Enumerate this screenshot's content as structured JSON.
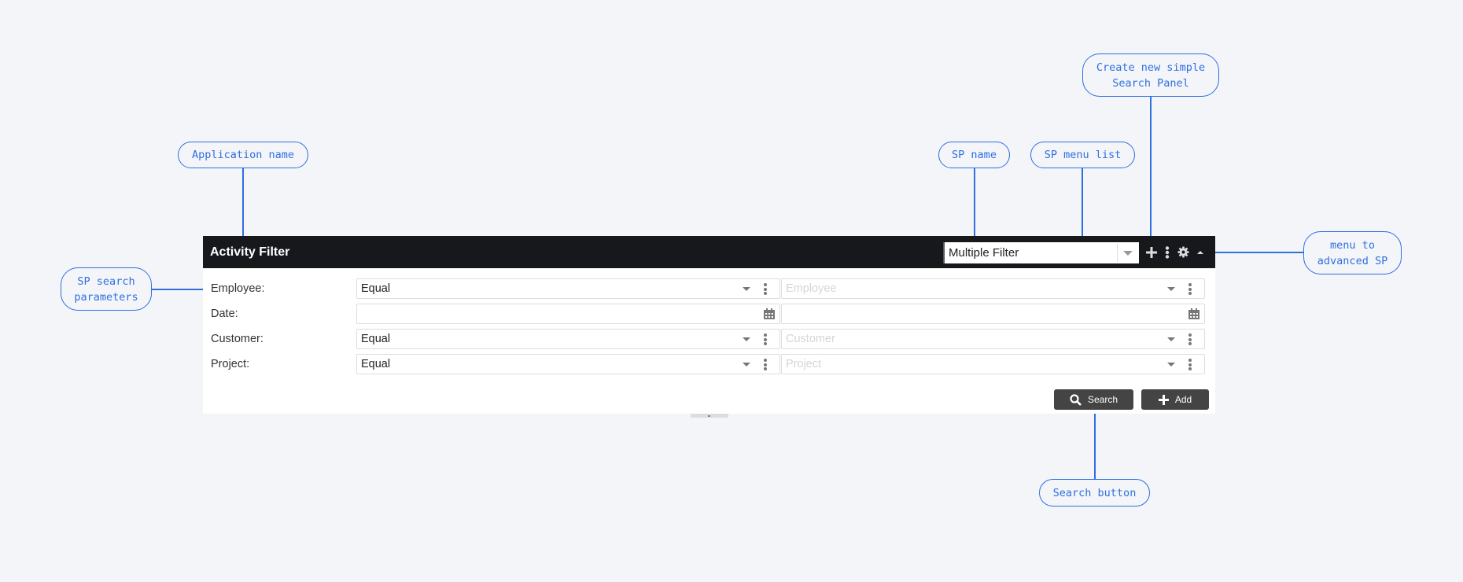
{
  "callouts": {
    "application_name": "Application name",
    "sp_search_parameters": "SP search\nparameters",
    "sp_name": "SP name",
    "sp_menu_list": "SP menu list",
    "create_new": "Create new simple\nSearch Panel",
    "menu_advanced": "menu to\nadvanced SP",
    "search_button": "Search button"
  },
  "header": {
    "title": "Activity Filter",
    "sp_selected": "Multiple Filter",
    "icons": [
      "plus-icon",
      "kebab-menu-icon",
      "gear-icon",
      "collapse-up-icon"
    ]
  },
  "rows": [
    {
      "label": "Employee:",
      "operator": "Equal",
      "value_placeholder": "Employee",
      "type": "select"
    },
    {
      "label": "Date:",
      "operator": "",
      "value_placeholder": "",
      "type": "date"
    },
    {
      "label": "Customer:",
      "operator": "Equal",
      "value_placeholder": "Customer",
      "type": "select"
    },
    {
      "label": "Project:",
      "operator": "Equal",
      "value_placeholder": "Project",
      "type": "select"
    }
  ],
  "actions": {
    "search_label": "Search",
    "add_label": "Add"
  },
  "colors": {
    "accent": "#2f6fe0",
    "header_bg": "#16181c",
    "button_bg": "#444444"
  }
}
